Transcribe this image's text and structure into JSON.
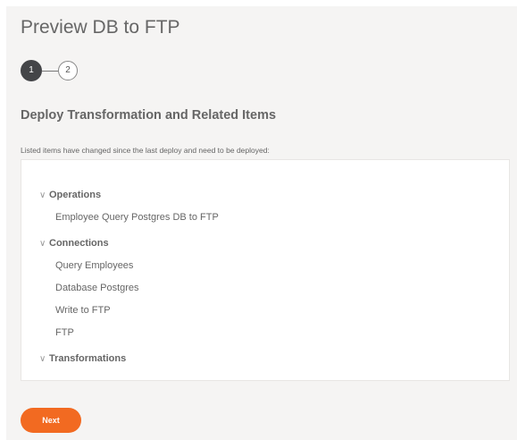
{
  "page": {
    "title": "Preview DB to FTP"
  },
  "stepper": {
    "step1": "1",
    "step2": "2"
  },
  "section": {
    "title": "Deploy Transformation and Related Items",
    "description": "Listed items have changed since the last deploy and need to be deployed:"
  },
  "groups": {
    "operations": {
      "label": "Operations",
      "items": [
        "Employee Query Postgres DB to FTP"
      ]
    },
    "connections": {
      "label": "Connections",
      "items": [
        "Query Employees",
        "Database Postgres",
        "Write to FTP",
        "FTP"
      ]
    },
    "transformations": {
      "label": "Transformations"
    }
  },
  "icons": {
    "chevron": "chevron-down-icon"
  },
  "colors": {
    "accent": "#f26a21",
    "step_active": "#444548"
  },
  "actions": {
    "next_label": "Next"
  }
}
